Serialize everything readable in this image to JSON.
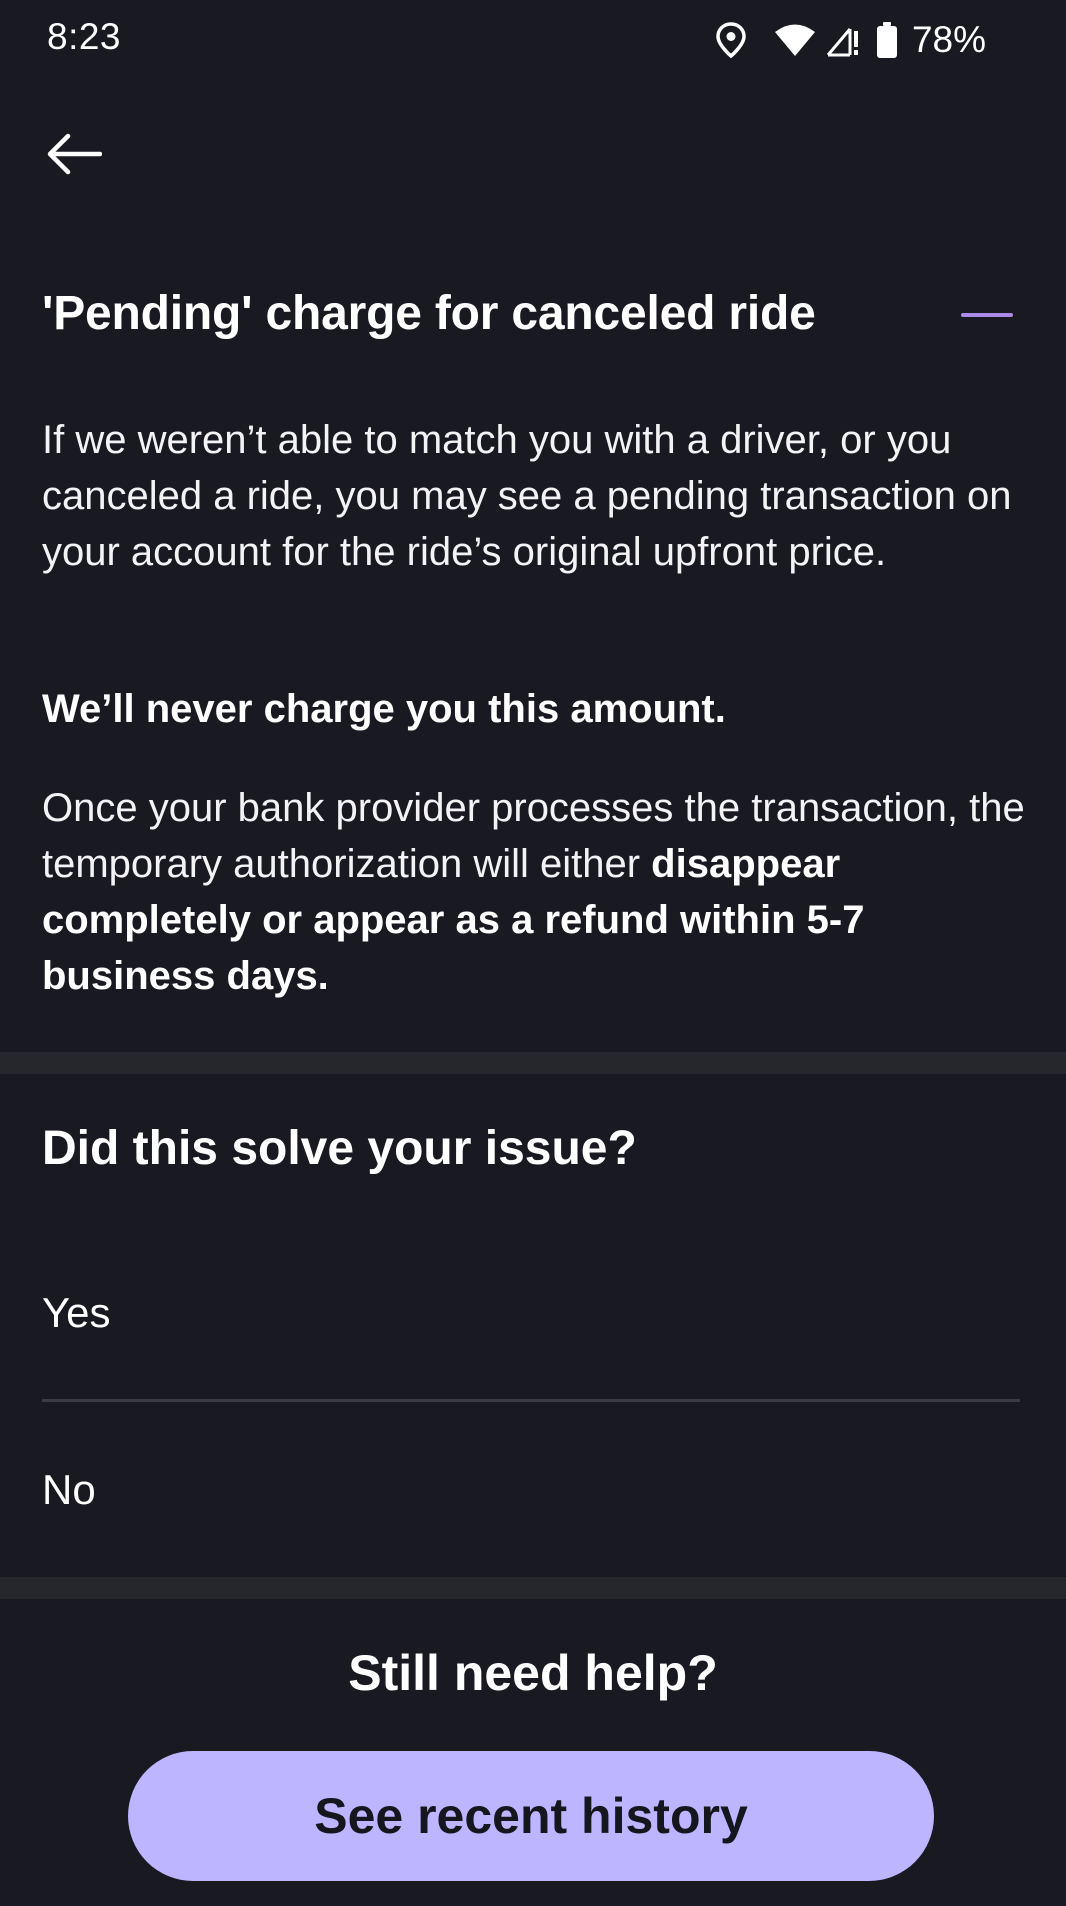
{
  "status_bar": {
    "time": "8:23",
    "battery": "78%",
    "icons": [
      "location-icon",
      "wifi-icon",
      "cell-signal-icon",
      "battery-icon"
    ]
  },
  "nav": {
    "back_icon": "arrow-left-icon"
  },
  "article": {
    "title": "'Pending' charge for canceled ride",
    "collapse_icon": "minus-icon",
    "paragraph_1": "If we weren’t able to match you with a driver, or you canceled a ride, you may see a pending transaction on your account for the ride’s original upfront price.",
    "paragraph_2": "We’ll never charge you this amount.",
    "paragraph_3_plain": "Once your bank provider processes the transaction, the temporary authorization will either ",
    "paragraph_3_bold": "disappear completely or appear as a refund within 5-7 business days."
  },
  "feedback": {
    "question": "Did this solve your issue?",
    "options": [
      "Yes",
      "No"
    ]
  },
  "help": {
    "title": "Still need help?",
    "button_label": "See recent history"
  },
  "colors": {
    "background": "#191a21",
    "accent": "#a98ae8",
    "button_bg": "#bdb5ff",
    "divider": "#26272d"
  }
}
